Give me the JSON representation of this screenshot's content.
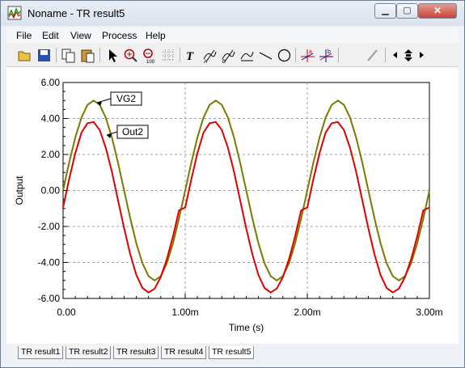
{
  "window": {
    "title": "Noname - TR result5"
  },
  "menu": [
    "File",
    "Edit",
    "View",
    "Process",
    "Help"
  ],
  "toolbar": {
    "icons": [
      "open-icon",
      "save-icon",
      "copy-icon",
      "paste-icon",
      "pointer-icon",
      "zoom-in-icon",
      "zoom-out-icon",
      "grid-icon",
      "text-icon",
      "label-icon",
      "label2-icon",
      "label3-icon",
      "line-icon",
      "circle-icon",
      "cursor-a-icon",
      "cursor-b-icon",
      "probe-icon",
      "nav-icon"
    ]
  },
  "tabs": [
    "TR result1",
    "TR result2",
    "TR result3",
    "TR result4",
    "TR result5"
  ],
  "active_tab": 4,
  "chart_data": {
    "type": "line",
    "xlabel": "Time (s)",
    "ylabel": "Output",
    "xlim": [
      0,
      3.0
    ],
    "ylim": [
      -6,
      6
    ],
    "x_ticks": [
      "0.00",
      "1.00m",
      "2.00m",
      "3.00m"
    ],
    "y_ticks": [
      "6.00",
      "4.00",
      "2.00",
      "0.00",
      "-2.00",
      "-4.00",
      "-6.00"
    ],
    "grid": true,
    "series": [
      {
        "name": "VG2",
        "color": "#7a7a00",
        "x": [
          0,
          0.05,
          0.1,
          0.15,
          0.2,
          0.25,
          0.3,
          0.35,
          0.4,
          0.45,
          0.5,
          0.55,
          0.6,
          0.65,
          0.7,
          0.75,
          0.8,
          0.85,
          0.9,
          0.95,
          1.0,
          1.05,
          1.1,
          1.15,
          1.2,
          1.25,
          1.3,
          1.35,
          1.4,
          1.45,
          1.5,
          1.55,
          1.6,
          1.65,
          1.7,
          1.75,
          1.8,
          1.85,
          1.9,
          1.95,
          2.0,
          2.05,
          2.1,
          2.15,
          2.2,
          2.25,
          2.3,
          2.35,
          2.4,
          2.45,
          2.5,
          2.55,
          2.6,
          2.65,
          2.7,
          2.75,
          2.8,
          2.85,
          2.9,
          2.95,
          3.0
        ],
        "y": [
          0.0,
          1.55,
          2.94,
          4.05,
          4.76,
          5.0,
          4.76,
          4.05,
          2.94,
          1.55,
          0.0,
          -1.55,
          -2.94,
          -4.05,
          -4.76,
          -5.0,
          -4.76,
          -4.05,
          -2.94,
          -1.55,
          0.0,
          1.55,
          2.94,
          4.05,
          4.76,
          5.0,
          4.76,
          4.05,
          2.94,
          1.55,
          0.0,
          -1.55,
          -2.94,
          -4.05,
          -4.76,
          -5.0,
          -4.76,
          -4.05,
          -2.94,
          -1.55,
          0.0,
          1.55,
          2.94,
          4.05,
          4.76,
          5.0,
          4.76,
          4.05,
          2.94,
          1.55,
          0.0,
          -1.55,
          -2.94,
          -4.05,
          -4.76,
          -5.0,
          -4.76,
          -4.05,
          -2.94,
          -1.55,
          0.0
        ]
      },
      {
        "name": "Out2",
        "color": "#e00000",
        "x": [
          0,
          0.05,
          0.1,
          0.15,
          0.2,
          0.25,
          0.3,
          0.35,
          0.4,
          0.45,
          0.5,
          0.55,
          0.6,
          0.65,
          0.7,
          0.75,
          0.8,
          0.85,
          0.9,
          0.95,
          1.0,
          1.05,
          1.1,
          1.15,
          1.2,
          1.25,
          1.3,
          1.35,
          1.4,
          1.45,
          1.5,
          1.55,
          1.6,
          1.65,
          1.7,
          1.75,
          1.8,
          1.85,
          1.9,
          1.95,
          2.0,
          2.05,
          2.1,
          2.15,
          2.2,
          2.25,
          2.3,
          2.35,
          2.4,
          2.45,
          2.5,
          2.55,
          2.6,
          2.65,
          2.7,
          2.75,
          2.8,
          2.85,
          2.9,
          2.95,
          3.0
        ],
        "y": [
          -0.95,
          0.63,
          2.07,
          3.21,
          3.74,
          3.8,
          3.36,
          2.37,
          1.04,
          -0.54,
          -2.11,
          -3.55,
          -4.7,
          -5.42,
          -5.67,
          -5.45,
          -4.81,
          -3.82,
          -2.55,
          -1.1,
          -0.95,
          0.63,
          2.07,
          3.21,
          3.74,
          3.8,
          3.36,
          2.37,
          1.04,
          -0.54,
          -2.11,
          -3.55,
          -4.7,
          -5.42,
          -5.67,
          -5.45,
          -4.81,
          -3.82,
          -2.55,
          -1.1,
          -0.95,
          0.63,
          2.07,
          3.21,
          3.74,
          3.8,
          3.36,
          2.37,
          1.04,
          -0.54,
          -2.11,
          -3.55,
          -4.7,
          -5.42,
          -5.67,
          -5.45,
          -4.81,
          -3.82,
          -2.55,
          -1.1,
          -0.95
        ]
      }
    ],
    "annotations": [
      "VG2",
      "Out2"
    ]
  }
}
